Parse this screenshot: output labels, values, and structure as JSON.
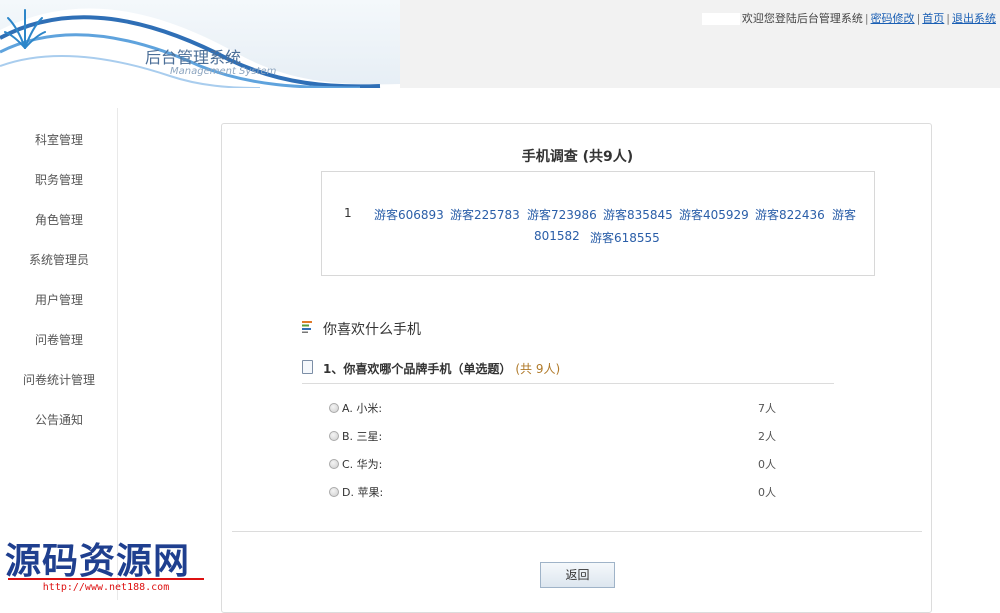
{
  "header": {
    "system_title": "后台管理系统",
    "system_subtitle": "Management System",
    "welcome_text": "欢迎您登陆后台管理系统",
    "links": [
      "密码修改",
      "首页",
      "退出系统"
    ]
  },
  "sidebar": {
    "items": [
      "科室管理",
      "职务管理",
      "角色管理",
      "系统管理员",
      "用户管理",
      "问卷管理",
      "问卷统计管理",
      "公告通知"
    ]
  },
  "survey": {
    "title": "手机调查 (共9人)",
    "participants_index": "1",
    "participants": [
      "游客606893",
      "游客225783",
      "游客723986",
      "游客835845",
      "游客405929",
      "游客822436",
      "游客",
      "801582",
      "游客618555"
    ],
    "section_title": "你喜欢什么手机",
    "question": {
      "text": "1、你喜欢哪个品牌手机（单选题）",
      "count": "(共 9人)",
      "options": [
        {
          "label": "A. 小米:",
          "count": "7人"
        },
        {
          "label": "B. 三星:",
          "count": "2人"
        },
        {
          "label": "C. 华为:",
          "count": "0人"
        },
        {
          "label": "D. 苹果:",
          "count": "0人"
        }
      ]
    },
    "back_button": "返回"
  },
  "watermark": {
    "text": "源码资源网",
    "url": "http://www.net188.com"
  },
  "colors": {
    "link": "#1a5fb4",
    "guest_link": "#2a5ea8",
    "count_accent": "#b07a2a",
    "watermark_blue": "#1f3f8f",
    "watermark_red": "#dd1111"
  }
}
